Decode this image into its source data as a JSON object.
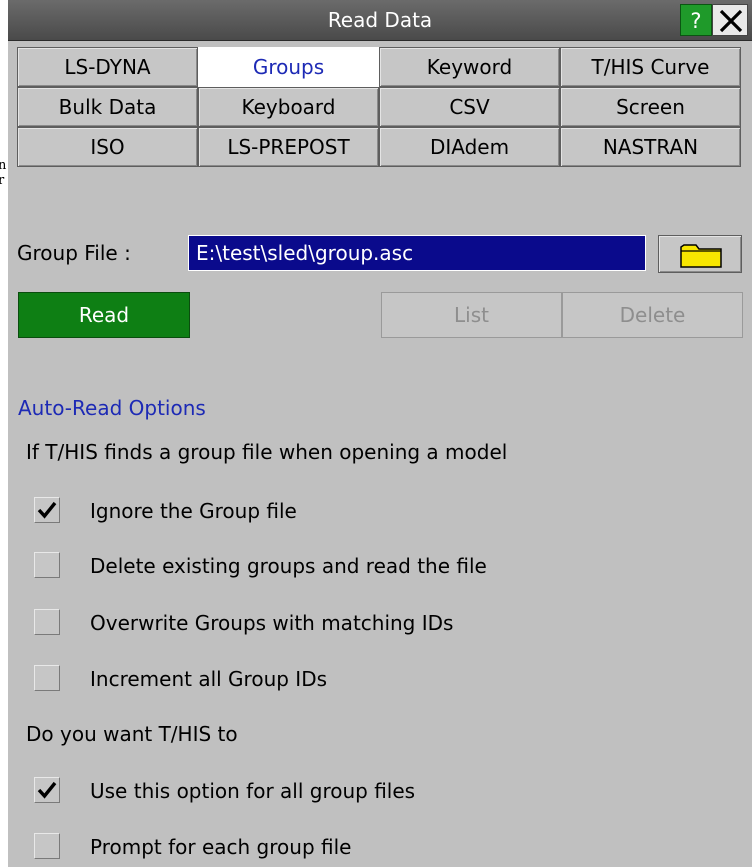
{
  "window": {
    "title": "Read Data",
    "help_label": "?"
  },
  "tabs": [
    {
      "label": "LS-DYNA",
      "active": false
    },
    {
      "label": "Groups",
      "active": true
    },
    {
      "label": "Keyword",
      "active": false
    },
    {
      "label": "T/HIS Curve",
      "active": false
    },
    {
      "label": "Bulk Data",
      "active": false
    },
    {
      "label": "Keyboard",
      "active": false
    },
    {
      "label": "CSV",
      "active": false
    },
    {
      "label": "Screen",
      "active": false
    },
    {
      "label": "ISO",
      "active": false
    },
    {
      "label": "LS-PREPOST",
      "active": false
    },
    {
      "label": "DIAdem",
      "active": false
    },
    {
      "label": "NASTRAN",
      "active": false
    }
  ],
  "group_file": {
    "label": "Group File :",
    "value": "E:\\test\\sled\\group.asc"
  },
  "actions": {
    "read": "Read",
    "list": "List",
    "delete": "Delete"
  },
  "auto_read": {
    "title": "Auto-Read Options",
    "prompt1": "If T/HIS finds a group file when opening a model",
    "options1": [
      {
        "label": "Ignore the Group file",
        "checked": true
      },
      {
        "label": "Delete existing groups and read the file",
        "checked": false
      },
      {
        "label": "Overwrite Groups with matching IDs",
        "checked": false
      },
      {
        "label": "Increment all Group IDs",
        "checked": false
      }
    ],
    "prompt2": "Do you want T/HIS to",
    "options2": [
      {
        "label": "Use this option for all group files",
        "checked": true
      },
      {
        "label": "Prompt for each group file",
        "checked": false
      }
    ]
  },
  "background": {
    "edge_text": "n\nr"
  },
  "colors": {
    "panel": "#c0c0c0",
    "title_bar": "#4a4a4a",
    "help": "#1f9a2a",
    "file_field": "#0a0a8c",
    "read_button": "#0e7f14",
    "accent_text": "#1d2ab5",
    "folder": "#f7e600"
  },
  "icons": {
    "help": "question-icon",
    "close": "close-icon",
    "folder": "folder-icon",
    "check": "checkmark-icon"
  }
}
